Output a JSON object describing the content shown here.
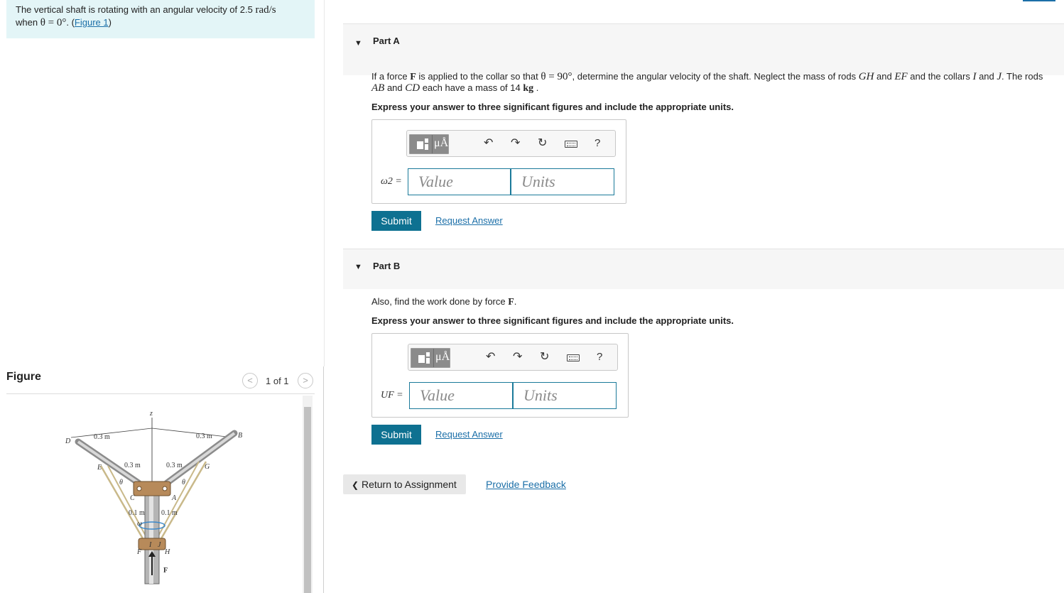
{
  "intro": {
    "line1_prefix": "The vertical shaft is rotating with an angular velocity of 2.5 ",
    "line1_unit": "rad/s",
    "line2_prefix": "when ",
    "line2_math": "θ = 0°",
    "line2_mid": ". (",
    "figure_link": "Figure 1",
    "line2_suffix": ")"
  },
  "figure_panel": {
    "heading": "Figure",
    "counter": "1 of 1",
    "prev_glyph": "<",
    "next_glyph": ">",
    "labels": {
      "z": "z",
      "D": "D",
      "B": "B",
      "E": "E",
      "G": "G",
      "C": "C",
      "A": "A",
      "I": "I",
      "J": "J",
      "F_collar": "F",
      "H": "H",
      "theta_left": "θ",
      "theta_right": "θ",
      "omega": "ω",
      "force": "F",
      "dim_outer_left": "0.3 m",
      "dim_outer_right": "0.3 m",
      "dim_inner_left": "0.3 m",
      "dim_inner_right": "0.3 m",
      "dim_small_left": "0.1 m",
      "dim_small_right": "0.1 m"
    }
  },
  "part_a": {
    "title": "Part A",
    "q_prefix": "If a force ",
    "q_F": "F",
    "q_mid1": " is applied to the collar so that ",
    "q_theta": "θ = 90°",
    "q_mid2": ", determine the angular velocity of the shaft. Neglect the mass of rods ",
    "q_GH": "GH",
    "q_and1": " and ",
    "q_EF": "EF",
    "q_mid3": " and the collars ",
    "q_I": "I",
    "q_and2": " and ",
    "q_J": "J",
    "q_end": ". The rods",
    "q2_AB": "AB",
    "q2_and": " and ",
    "q2_CD": "CD",
    "q2_mid": " each have a mass of 14 ",
    "q2_kg": "kg",
    "q2_end": " .",
    "instruction": "Express your answer to three significant figures and include the appropriate units.",
    "variable_label": "ω2 =",
    "value_placeholder": "Value",
    "units_placeholder": "Units",
    "submit": "Submit",
    "request_answer": "Request Answer"
  },
  "part_b": {
    "title": "Part B",
    "q_prefix": "Also, find the work done by force ",
    "q_F": "F",
    "q_end": ".",
    "instruction": "Express your answer to three significant figures and include the appropriate units.",
    "variable_label": "UF =",
    "value_placeholder": "Value",
    "units_placeholder": "Units",
    "submit": "Submit",
    "request_answer": "Request Answer"
  },
  "toolbar": {
    "units_symbol": "μÅ",
    "undo_glyph": "↶",
    "redo_glyph": "↷",
    "reset_glyph": "↻",
    "help_glyph": "?"
  },
  "footer": {
    "return_glyph": "❮",
    "return_label": "Return to Assignment",
    "feedback": "Provide Feedback"
  }
}
